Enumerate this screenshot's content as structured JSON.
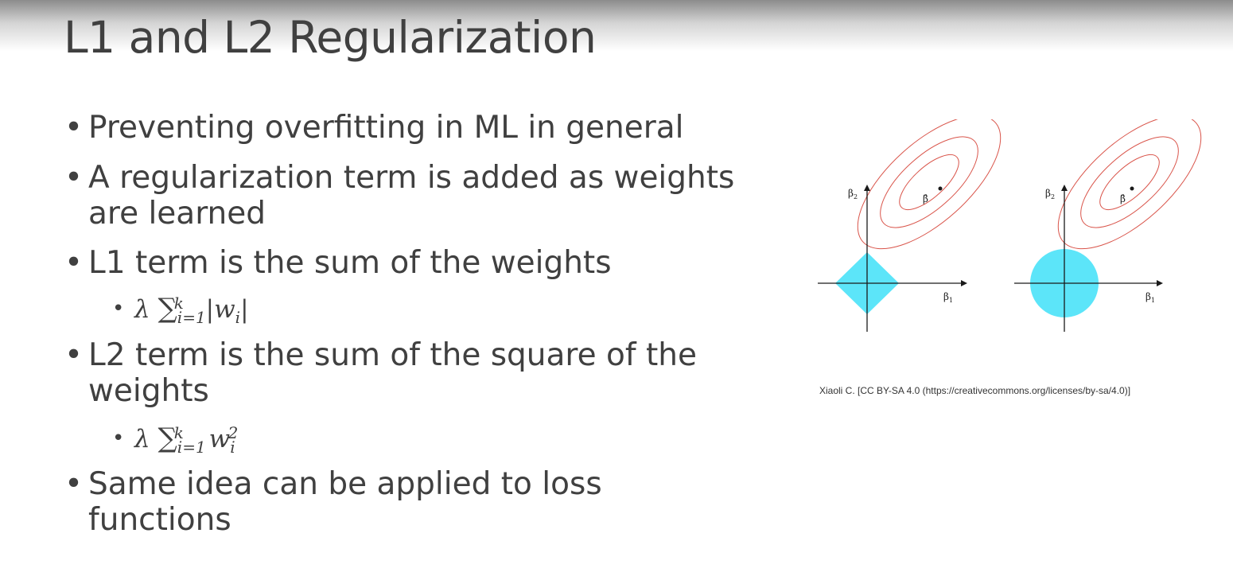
{
  "slide": {
    "title": "L1 and L2 Regularization",
    "bullet_marker": "•"
  },
  "bullets": [
    {
      "lines": [
        "Preventing overfitting in ML in general"
      ]
    },
    {
      "lines": [
        "A regularization term is added as weights",
        "are learned"
      ]
    },
    {
      "lines": [
        "L1 term is the sum of the weights"
      ]
    },
    {
      "lines": [
        "L2 term is the sum of the square of the",
        "weights"
      ]
    },
    {
      "lines": [
        "Same idea can be applied to loss",
        "functions"
      ]
    }
  ],
  "formulas": {
    "l1": {
      "lambda": "λ",
      "sum": "∑",
      "lower": "i=1",
      "upper": "k",
      "body_open": "|",
      "body": "w",
      "index": "i",
      "body_close": "|"
    },
    "l2": {
      "lambda": "λ",
      "sum": "∑",
      "lower": "i=1",
      "upper": "k",
      "body": "w",
      "index": "i",
      "power": "2"
    }
  },
  "figure": {
    "beta_hat": "β̂",
    "axis_y_label": "β",
    "axis_y_sub": "2",
    "axis_x_label": "β",
    "axis_x_sub": "1",
    "credit": "Xiaoli C. [CC BY-SA 4.0 (https://creativecommons.org/licenses/by-sa/4.0)]",
    "colors": {
      "constraint": "#5ce5f9",
      "contour": "#d9544a",
      "axis": "#1a1a1a"
    }
  }
}
